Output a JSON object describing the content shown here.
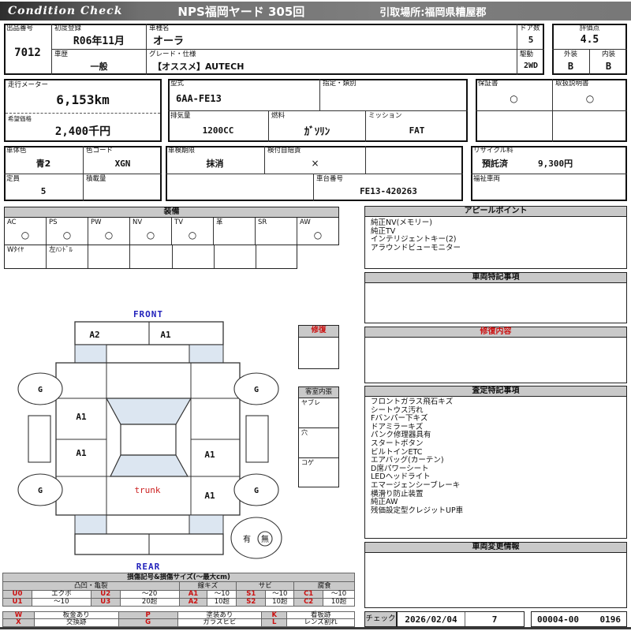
{
  "header": {
    "brand": "Condition  Check",
    "venue": "NPS福岡ヤード 305回",
    "pickup": "引取場所:福岡県糟屋郡"
  },
  "info": {
    "lot_label": "出品番号",
    "lot": "7012",
    "first_reg_label": "初度登録",
    "first_reg": "R06年11月",
    "history_label": "車歴",
    "history": "一般",
    "model_name_label": "車種名",
    "model_name": "オーラ",
    "grade_label": "グレード・仕様",
    "grade": "【オススメ】AUTECH",
    "doors_label": "ドア数",
    "doors": "5",
    "drive_label": "駆動",
    "drive": "2WD",
    "score_label": "評価点",
    "score": "4.5",
    "exterior_label": "外装",
    "exterior": "B",
    "interior_label": "内装",
    "interior": "B",
    "odometer_label": "走行メーター",
    "odometer": "6,153km",
    "price_label": "希望価格",
    "price": "2,400千円",
    "model_code_label": "型式",
    "model_code": "6AA-FE13",
    "class_label": "指定・類別",
    "class_value": "",
    "displacement_label": "排気量",
    "displacement": "1200CC",
    "fuel_label": "燃料",
    "fuel": "ｶﾞｿﾘﾝ",
    "mission_label": "ミッション",
    "mission": "FAT",
    "warranty_label": "保証書",
    "warranty": "○",
    "manual_label": "取扱説明書",
    "manual": "○",
    "body_color_label": "車体色",
    "body_color": "青2",
    "color_code_label": "色コード",
    "color_code": "XGN",
    "inspection_label": "車検期限",
    "inspection": "抹消",
    "insurance_label": "検付自賠責",
    "insurance": "×",
    "capacity_label": "定員",
    "capacity": "5",
    "load_label": "積載量",
    "load": "",
    "chassis_label": "車台番号",
    "chassis": "FE13-420263",
    "recycle_label": "リサイクル料",
    "recycle_status": "預託済",
    "recycle_fee": "9,300円",
    "welfare_label": "福祉車両",
    "welfare": ""
  },
  "equipment": {
    "title": "装備",
    "items": [
      {
        "label": "AC",
        "mark": "○"
      },
      {
        "label": "PS",
        "mark": "○"
      },
      {
        "label": "PW",
        "mark": "○"
      },
      {
        "label": "NV",
        "mark": "○"
      },
      {
        "label": "TV",
        "mark": "○"
      },
      {
        "label": "革",
        "mark": ""
      },
      {
        "label": "SR",
        "mark": ""
      },
      {
        "label": "AW",
        "mark": "○"
      }
    ],
    "extra": [
      {
        "label": "Wﾀｲﾔ"
      },
      {
        "label": "左ﾊﾝﾄﾞﾙ"
      },
      {
        "label": ""
      },
      {
        "label": ""
      },
      {
        "label": ""
      },
      {
        "label": ""
      },
      {
        "label": ""
      }
    ]
  },
  "appeal": {
    "title": "アピールポイント",
    "items": [
      "純正NV(メモリー)",
      "純正TV",
      "インテリジェントキー(2)",
      "アラウンドビューモニター"
    ]
  },
  "special_notes": {
    "title": "車両特記事項",
    "body": ""
  },
  "repair_content": {
    "title": "修復内容",
    "body": ""
  },
  "assessment": {
    "title": "査定特記事項",
    "items": [
      "フロントガラス飛石キズ",
      "シートウス汚れ",
      "Fバンパー下キズ",
      "ドアミラーキズ",
      "パンク修理器具有",
      "スタートボタン",
      "ビルトインETC",
      "エアバッグ(カーテン)",
      "D席パワーシート",
      "LEDヘッドライト",
      "エマージェンシーブレーキ",
      "横滑り防止装置",
      "純正AW",
      "残価設定型クレジットUP車"
    ]
  },
  "change_info": {
    "title": "車両変更情報",
    "body": ""
  },
  "check": {
    "label": "チェック",
    "date": "2026/02/04",
    "num": "7",
    "code": "00004-00",
    "page": "0196"
  },
  "diagram": {
    "front": "FRONT",
    "rear": "REAR",
    "trunk": "trunk",
    "a2": "A2",
    "a1": "A1",
    "wheel": "G",
    "spare_yes": "有",
    "spare_no": "無",
    "repair_title": "修復",
    "interior_title": "客室内張",
    "interior_rows": [
      "ヤブレ",
      "穴",
      "コゲ"
    ]
  },
  "legend": {
    "title": "損傷記号&損傷サイズ(〜最大cm)",
    "groups": [
      "凸凹・亀裂",
      "線キズ",
      "サビ",
      "腐食"
    ],
    "rows": [
      [
        "U0",
        "エクボ",
        "U2",
        "〜20",
        "A1",
        "〜10",
        "S1",
        "〜10",
        "C1",
        "〜10"
      ],
      [
        "U1",
        "〜10",
        "U3",
        "20超",
        "A2",
        "10超",
        "S2",
        "10超",
        "C2",
        "10超"
      ]
    ],
    "rows2": [
      [
        "W",
        "板金あり",
        "P",
        "塗装あり",
        "K",
        "看板跡"
      ],
      [
        "X",
        "交換跡",
        "G",
        "ガラスヒビ",
        "L",
        "レンズ割れ"
      ]
    ]
  },
  "colors": {
    "accent_blue": "#2222bb",
    "accent_red": "#cc1111",
    "light_blue": "#dce6f1",
    "bar_gray": "#c9c9c9"
  }
}
